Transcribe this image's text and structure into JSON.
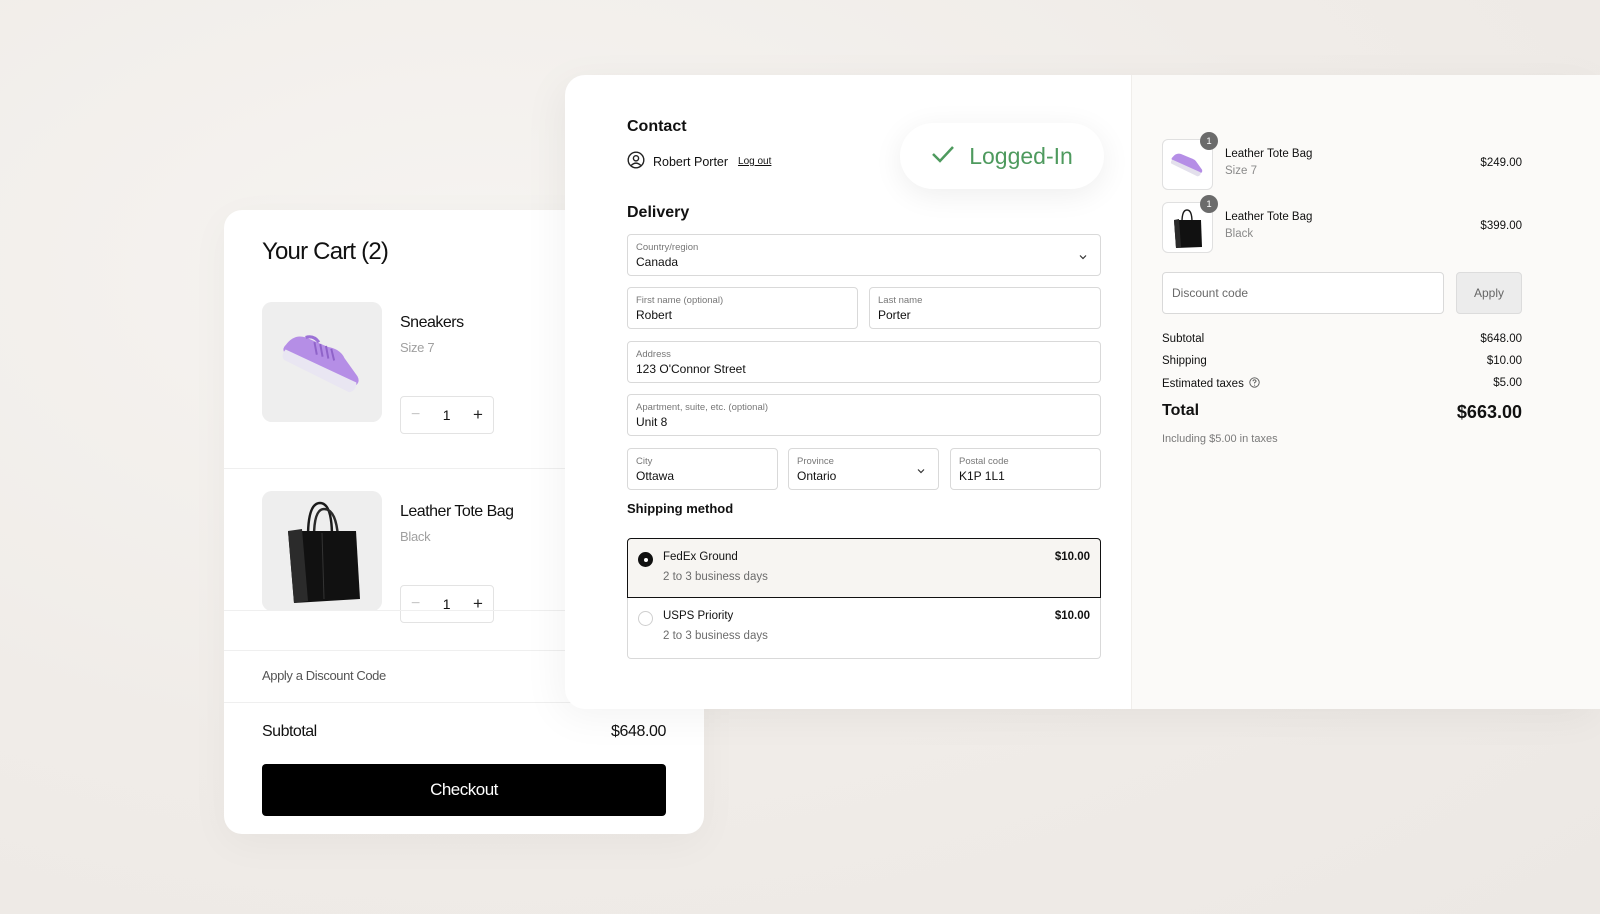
{
  "cart": {
    "title": "Your Cart (2)",
    "items": [
      {
        "name": "Sneakers",
        "variant": "Size 7",
        "quantity": "1",
        "image_icon": "purple-sneaker-image"
      },
      {
        "name": "Leather Tote Bag",
        "variant": "Black",
        "quantity": "1",
        "image_icon": "black-tote-bag-image"
      }
    ],
    "stepper": {
      "minus": "−",
      "plus": "+"
    },
    "discount_label": "Apply a Discount Code",
    "subtotal_label": "Subtotal",
    "subtotal_value": "$648.00",
    "checkout_label": "Checkout"
  },
  "contact": {
    "heading": "Contact",
    "user_name": "Robert Porter",
    "logout_label": "Log out",
    "logged_in_label": "Logged-In",
    "logged_in_color": "#4e9a5e"
  },
  "delivery": {
    "heading": "Delivery",
    "country": {
      "label": "Country/region",
      "value": "Canada"
    },
    "first_name": {
      "label": "First name (optional)",
      "value": "Robert"
    },
    "last_name": {
      "label": "Last name",
      "value": "Porter"
    },
    "address": {
      "label": "Address",
      "value": "123 O'Connor Street"
    },
    "apartment": {
      "label": "Apartment, suite, etc. (optional)",
      "value": "Unit 8"
    },
    "city": {
      "label": "City",
      "value": "Ottawa"
    },
    "province": {
      "label": "Province",
      "value": "Ontario"
    },
    "postal": {
      "label": "Postal code",
      "value": "K1P 1L1"
    }
  },
  "shipping": {
    "heading": "Shipping method",
    "options": [
      {
        "name": "FedEx Ground",
        "days": "2 to 3 business days",
        "price": "$10.00",
        "selected": true
      },
      {
        "name": "USPS Priority",
        "days": "2 to 3 business days",
        "price": "$10.00",
        "selected": false
      }
    ]
  },
  "summary": {
    "items": [
      {
        "name": "Leather Tote Bag",
        "variant": "Size 7",
        "price": "$249.00",
        "badge": "1"
      },
      {
        "name": "Leather Tote Bag",
        "variant": "Black",
        "price": "$399.00",
        "badge": "1"
      }
    ],
    "discount_placeholder": "Discount code",
    "apply_label": "Apply",
    "subtotal_label": "Subtotal",
    "subtotal_value": "$648.00",
    "shipping_label": "Shipping",
    "shipping_value": "$10.00",
    "taxes_label": "Estimated taxes",
    "taxes_value": "$5.00",
    "total_label": "Total",
    "total_value": "$663.00",
    "tax_note": "Including $5.00 in taxes"
  }
}
